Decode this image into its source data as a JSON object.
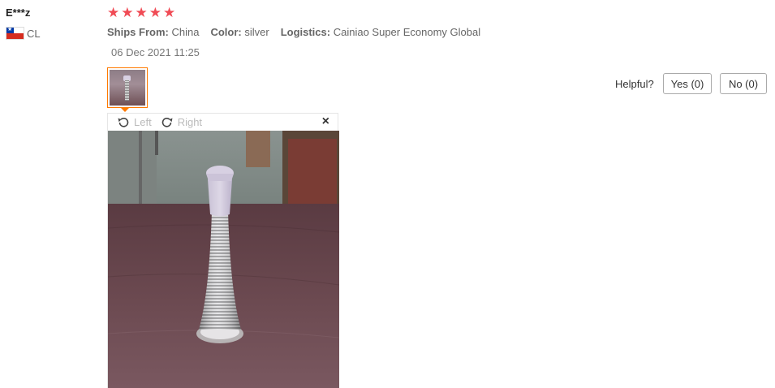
{
  "review": {
    "user": "E***z",
    "country": "CL",
    "stars": [
      "★",
      "★",
      "★",
      "★",
      "★"
    ],
    "star_color": "#f04b55",
    "ships_from_key": "Ships From:",
    "ships_from_val": "China",
    "color_key": "Color:",
    "color_val": "silver",
    "logistics_key": "Logistics:",
    "logistics_val": "Cainiao Super Economy Global",
    "date": "06 Dec 2021 11:25"
  },
  "helpful": {
    "label": "Helpful?",
    "yes": "Yes (0)",
    "no": "No (0)"
  },
  "viewer": {
    "rotate_left": "Left",
    "rotate_right": "Right",
    "close": "×"
  },
  "accent_color": "#ff7a00"
}
